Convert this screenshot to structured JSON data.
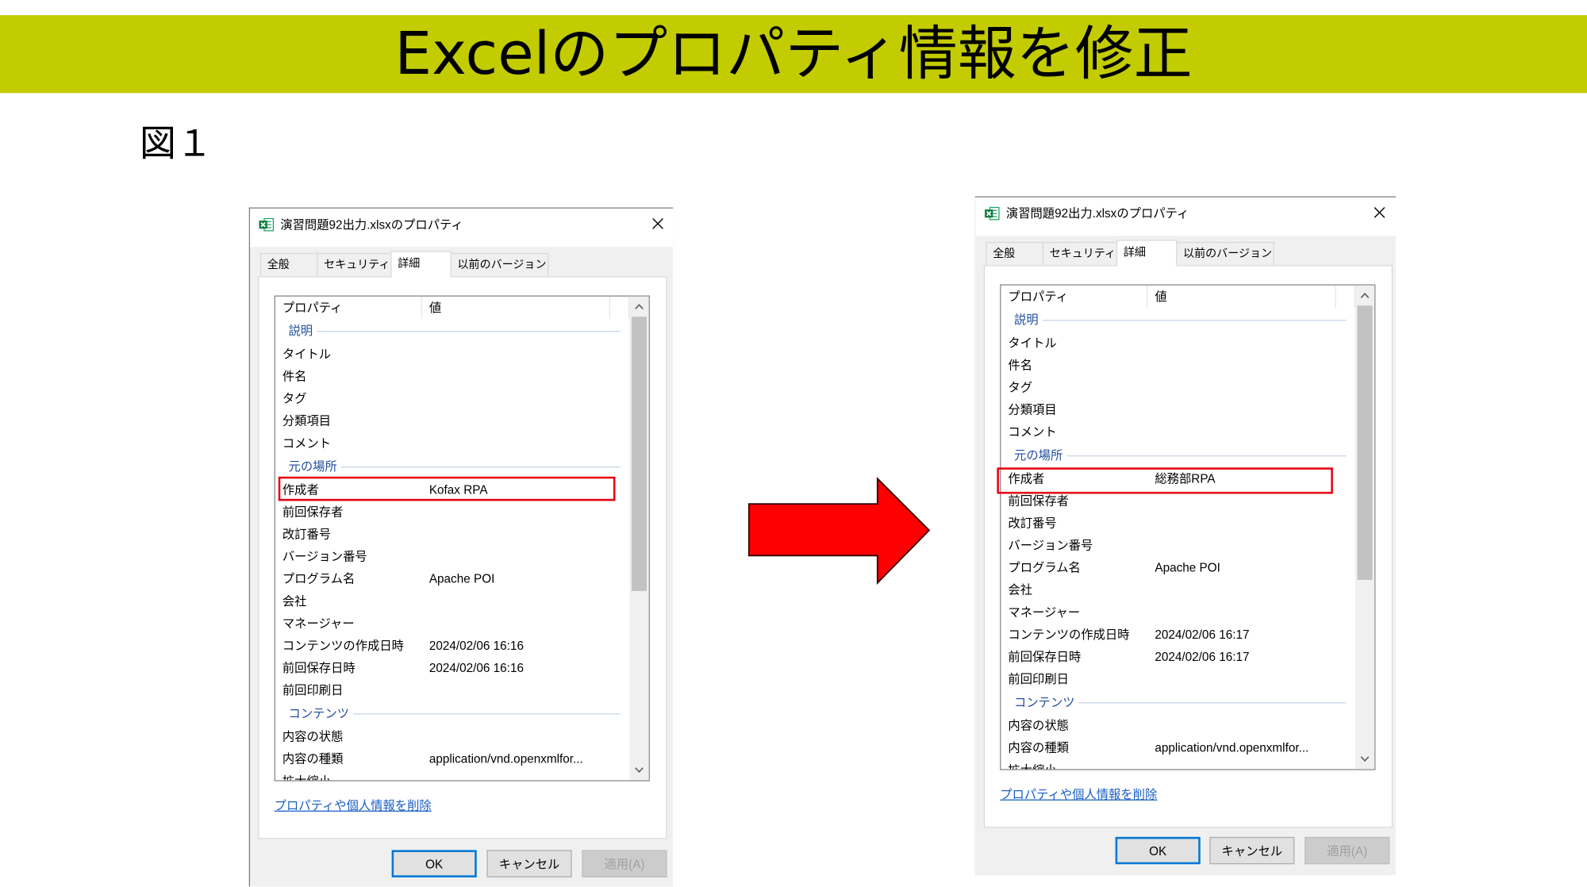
{
  "colors": {
    "banner_bg": "#c3cc00",
    "arrow_fill": "#ff0000",
    "arrow_outline": "#3a0000",
    "highlight_border": "#e60012",
    "group_heading": "#1f4e9d",
    "link": "#1a5fc4",
    "default_button_border": "#0078d7"
  },
  "banner": {
    "title": "Excelのプロパティ情報を修正"
  },
  "figure_label": "図１",
  "arrow_icon": "right-arrow-icon",
  "dialogs": [
    {
      "title": "演習問題92出力.xlsxのプロパティ",
      "file_icon": "excel-file-icon",
      "tabs": [
        {
          "label": "全般"
        },
        {
          "label": "セキュリティ"
        },
        {
          "label": "詳細",
          "selected": true
        },
        {
          "label": "以前のバージョン"
        }
      ],
      "columns": [
        "プロパティ",
        "値"
      ],
      "rows": [
        {
          "type": "group",
          "label": "説明"
        },
        {
          "type": "property",
          "label": "タイトル"
        },
        {
          "type": "property",
          "label": "件名"
        },
        {
          "type": "property",
          "label": "タグ"
        },
        {
          "type": "property",
          "label": "分類項目"
        },
        {
          "type": "property",
          "label": "コメント"
        },
        {
          "type": "group",
          "label": "元の場所"
        },
        {
          "type": "property",
          "label": "作成者",
          "value": "Kofax RPA",
          "highlight": true
        },
        {
          "type": "property",
          "label": "前回保存者"
        },
        {
          "type": "property",
          "label": "改訂番号"
        },
        {
          "type": "property",
          "label": "バージョン番号"
        },
        {
          "type": "property",
          "label": "プログラム名",
          "value": "Apache POI"
        },
        {
          "type": "property",
          "label": "会社"
        },
        {
          "type": "property",
          "label": "マネージャー"
        },
        {
          "type": "property",
          "label": "コンテンツの作成日時",
          "value": "2024/02/06 16:16"
        },
        {
          "type": "property",
          "label": "前回保存日時",
          "value": "2024/02/06 16:16"
        },
        {
          "type": "property",
          "label": "前回印刷日"
        },
        {
          "type": "group",
          "label": "コンテンツ"
        },
        {
          "type": "property",
          "label": "内容の状態"
        },
        {
          "type": "property",
          "label": "内容の種類",
          "value": "application/vnd.openxmlfor..."
        },
        {
          "type": "property",
          "label": "拡大縮小"
        }
      ],
      "link": "プロパティや個人情報を削除",
      "buttons": [
        {
          "label": "OK",
          "default": true
        },
        {
          "label": "キャンセル"
        },
        {
          "label": "適用(A)",
          "disabled": true
        }
      ]
    },
    {
      "title": "演習問題92出力.xlsxのプロパティ",
      "file_icon": "excel-file-icon",
      "tabs": [
        {
          "label": "全般"
        },
        {
          "label": "セキュリティ"
        },
        {
          "label": "詳細",
          "selected": true
        },
        {
          "label": "以前のバージョン"
        }
      ],
      "columns": [
        "プロパティ",
        "値"
      ],
      "rows": [
        {
          "type": "group",
          "label": "説明"
        },
        {
          "type": "property",
          "label": "タイトル"
        },
        {
          "type": "property",
          "label": "件名"
        },
        {
          "type": "property",
          "label": "タグ"
        },
        {
          "type": "property",
          "label": "分類項目"
        },
        {
          "type": "property",
          "label": "コメント"
        },
        {
          "type": "group",
          "label": "元の場所"
        },
        {
          "type": "property",
          "label": "作成者",
          "value": "総務部RPA",
          "highlight": true
        },
        {
          "type": "property",
          "label": "前回保存者"
        },
        {
          "type": "property",
          "label": "改訂番号"
        },
        {
          "type": "property",
          "label": "バージョン番号"
        },
        {
          "type": "property",
          "label": "プログラム名",
          "value": "Apache POI"
        },
        {
          "type": "property",
          "label": "会社"
        },
        {
          "type": "property",
          "label": "マネージャー"
        },
        {
          "type": "property",
          "label": "コンテンツの作成日時",
          "value": "2024/02/06 16:17"
        },
        {
          "type": "property",
          "label": "前回保存日時",
          "value": "2024/02/06 16:17"
        },
        {
          "type": "property",
          "label": "前回印刷日"
        },
        {
          "type": "group",
          "label": "コンテンツ"
        },
        {
          "type": "property",
          "label": "内容の状態"
        },
        {
          "type": "property",
          "label": "内容の種類",
          "value": "application/vnd.openxmlfor..."
        },
        {
          "type": "property",
          "label": "拡大縮小"
        }
      ],
      "link": "プロパティや個人情報を削除",
      "buttons": [
        {
          "label": "OK",
          "default": true
        },
        {
          "label": "キャンセル"
        },
        {
          "label": "適用(A)",
          "disabled": true
        }
      ]
    }
  ]
}
